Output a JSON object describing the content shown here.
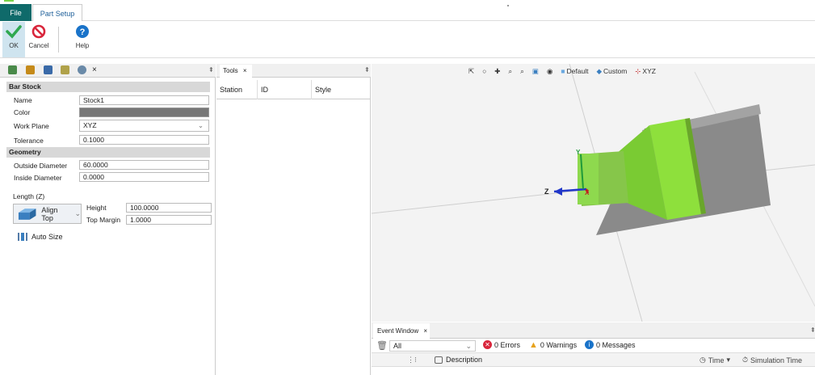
{
  "menu": {
    "file_label": "File",
    "setup_label": "Part Setup"
  },
  "ribbon": {
    "ok_label": "OK",
    "cancel_label": "Cancel",
    "help_label": "Help"
  },
  "left_panel": {
    "close": "×",
    "pin": "⇞",
    "bar_stock": {
      "title": "Bar Stock",
      "name_label": "Name",
      "name_value": "Stock1",
      "color_label": "Color",
      "work_plane_label": "Work Plane",
      "work_plane_value": "XYZ",
      "tolerance_label": "Tolerance",
      "tolerance_value": "0.1000"
    },
    "geometry": {
      "title": "Geometry",
      "outside_label": "Outside Diameter",
      "outside_value": "60.0000",
      "inside_label": "Inside Diameter",
      "inside_value": "0.0000"
    },
    "length": {
      "label": "Length (Z)",
      "align_label": "Align Top",
      "height_label": "Height",
      "height_value": "100.0000",
      "top_margin_label": "Top Margin",
      "top_margin_value": "1.0000"
    },
    "auto_size_label": "Auto Size"
  },
  "tools_panel": {
    "tab_label": "Tools",
    "close": "×",
    "pin": "⇞",
    "columns": [
      "Station",
      "ID",
      "Style"
    ]
  },
  "viewport": {
    "toolbar": {
      "default_label": "Default",
      "custom_label": "Custom",
      "xyz_label": "XYZ"
    },
    "axes": {
      "z": "Z",
      "x": "X",
      "y": "Y"
    }
  },
  "event_window": {
    "tab_label": "Event Window",
    "close": "×",
    "filter_value": "All",
    "errors_label": "0 Errors",
    "warnings_label": "0 Warnings",
    "messages_label": "0 Messages",
    "description_label": "Description",
    "time_label": "Time",
    "sim_time_label": "Simulation Time"
  },
  "colors": {
    "accent": "#0f6a6a",
    "part_green": "#8ee03c",
    "stock_gray": "#8a8a8a"
  }
}
